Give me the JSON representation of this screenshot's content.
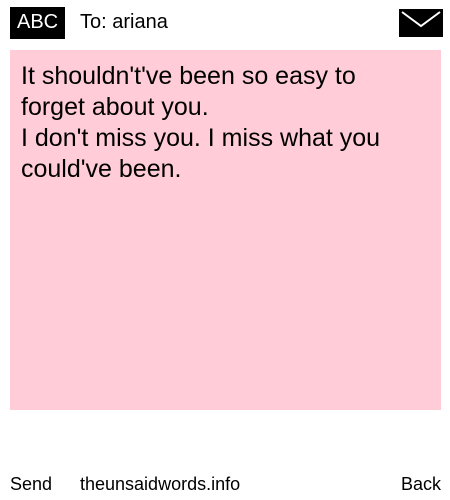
{
  "header": {
    "input_mode": "ABC",
    "recipient": "To: ariana",
    "envelope_icon": "envelope-icon"
  },
  "message": {
    "first_text": "It shouldn't've been so easy to forget about you.",
    "second_text": "I don't miss you. I miss what you could've been.",
    "background_color": "#ffccd8"
  },
  "footer": {
    "send_label": "Send",
    "site_label": "theunsaidwords.info",
    "back_label": "Back"
  }
}
